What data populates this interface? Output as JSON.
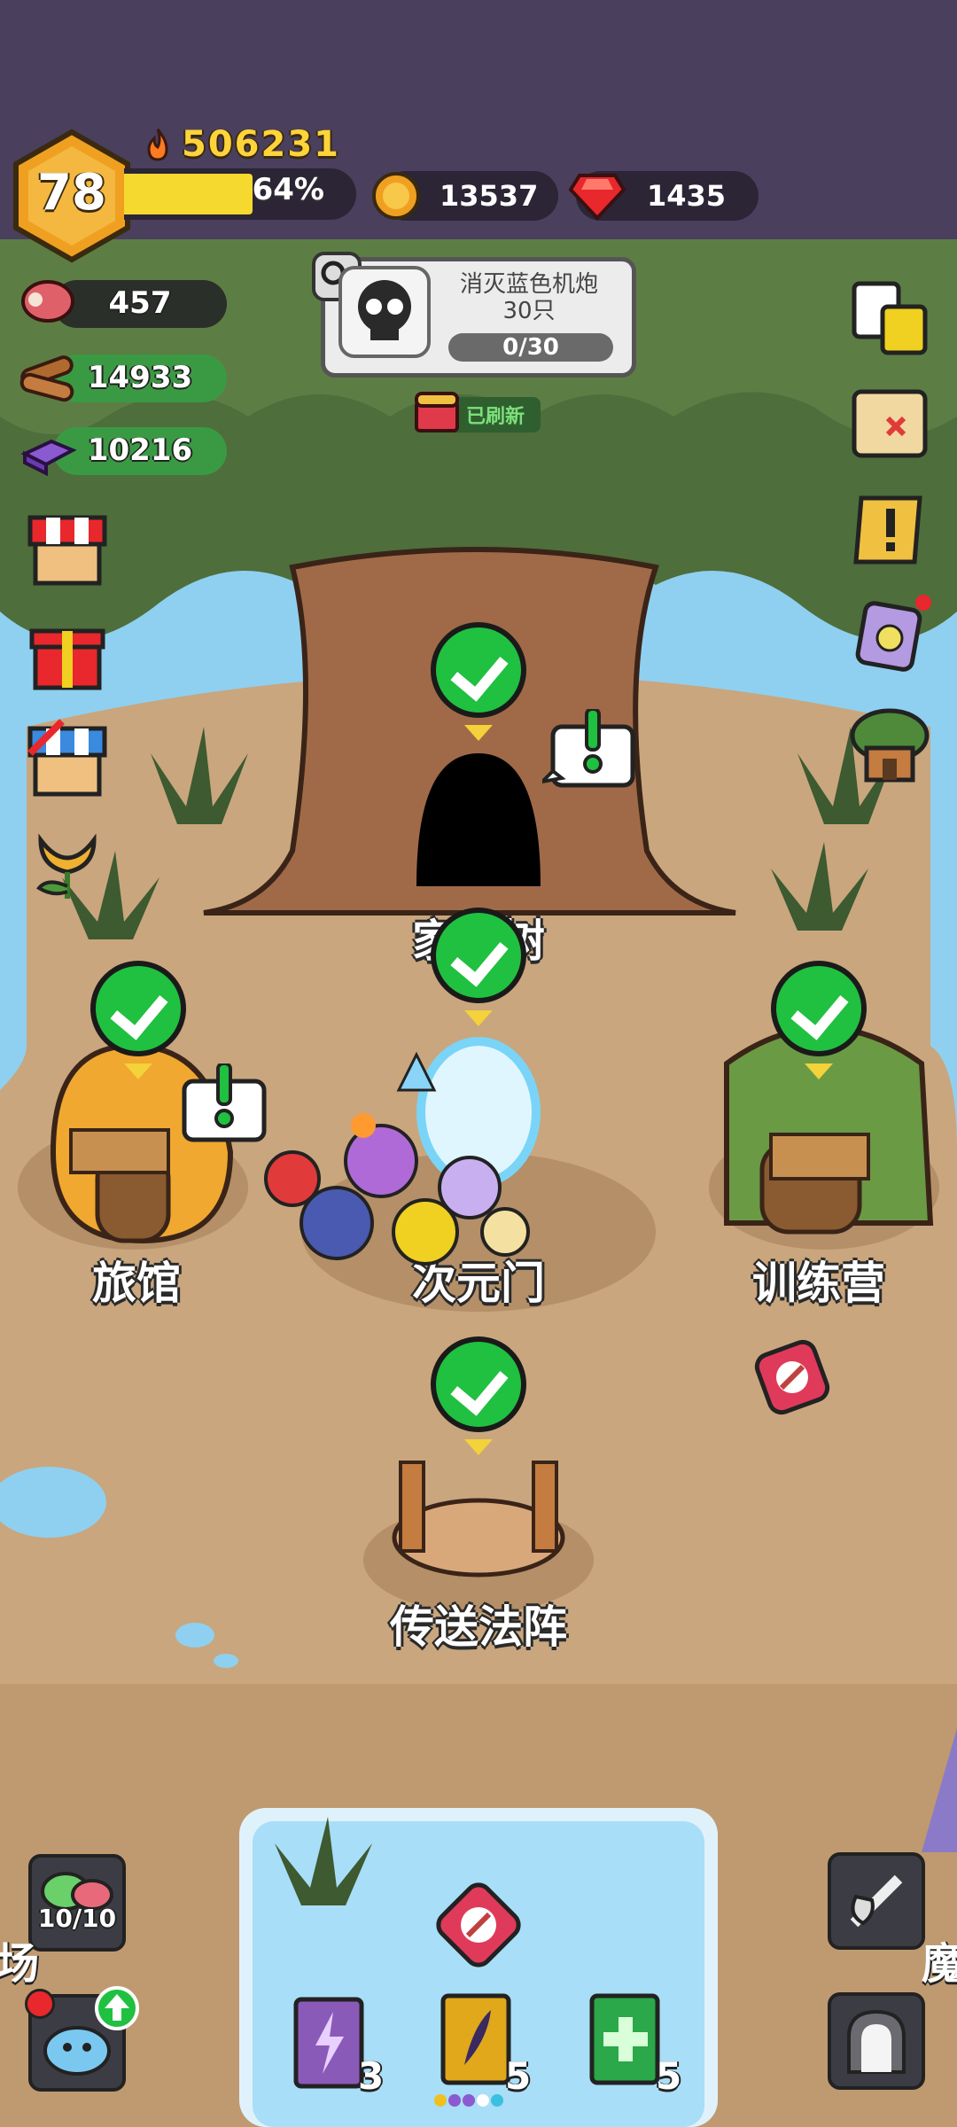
{
  "player": {
    "level": "78",
    "power": "506231",
    "xp_percent_label": "64%",
    "xp_fraction": 0.64
  },
  "currencies": {
    "gold": "13537",
    "gems": "1435"
  },
  "resources": {
    "meat": "457",
    "wood": "14933",
    "crystal": "10216"
  },
  "quest": {
    "title": "消灭蓝色机炮30只",
    "progress": "0/30",
    "refresh_badge": "已刷新"
  },
  "buildings": {
    "home_tree": "家园树",
    "tavern": "旅馆",
    "portal": "次元门",
    "training_camp": "训练营",
    "teleport_array": "传送法阵"
  },
  "bottom": {
    "slime_count": "10/10",
    "left_edge_label": "场",
    "right_edge_label": "魔",
    "spellbooks": [
      {
        "icon": "lightning-book-icon",
        "count": "3",
        "color": "#8a5ab8"
      },
      {
        "icon": "feather-book-icon",
        "count": "5",
        "color": "#e0a81a"
      },
      {
        "icon": "heal-book-icon",
        "count": "5",
        "color": "#2aa84a"
      }
    ]
  },
  "colors": {
    "hud_bg": "#4a3f5c",
    "check_green": "#20c040",
    "gold_text": "#ffd43a",
    "ground": "#c9a67e",
    "water": "#8fd0f0"
  }
}
